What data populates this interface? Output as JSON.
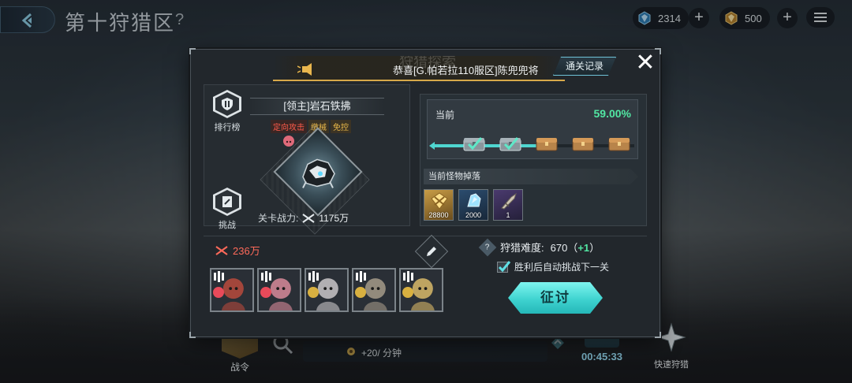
{
  "top_bar": {
    "back_icon": "back-chevron-icon",
    "zone_title": "第十狩猎区",
    "help_mark": "?",
    "currency1_value": "2314",
    "currency1_icon": "blue-crystal-icon",
    "currency2_value": "500",
    "currency2_icon": "gold-crystal-icon",
    "plus": "+",
    "menu_icon": "hamburger-menu-icon"
  },
  "bottom_bar": {
    "pass_label": "战令",
    "rate_text": "+20/ 分钟",
    "timer": "00:45:33",
    "quick_hunt_label": "快速狩猎"
  },
  "modal": {
    "broadcast": "恭喜[G.帕若拉110服区]陈兜兜将",
    "ghost_title": "狩猎探索",
    "records_button": "通关记录",
    "close_icon": "close-x-icon",
    "ranking_label": "排行榜",
    "challenge_label": "挑战",
    "boss": {
      "name": "[领主]岩石铁拂",
      "tags": [
        "定向攻击",
        "缴械",
        "免控"
      ],
      "power_label": "关卡战力:",
      "power_value": "1175万"
    },
    "progress": {
      "label": "当前",
      "percent": "59.00%",
      "fill_fraction": 0.59,
      "milestones": [
        {
          "state": "claimed"
        },
        {
          "state": "claimed"
        },
        {
          "state": "locked"
        },
        {
          "state": "locked"
        },
        {
          "state": "locked"
        }
      ]
    },
    "drops": {
      "title": "当前怪物掉落",
      "items": [
        {
          "name": "gold-currency",
          "qty": "28800"
        },
        {
          "name": "blue-crystal",
          "qty": "2000"
        },
        {
          "name": "weapon-part",
          "qty": "1"
        }
      ]
    },
    "team": {
      "power": "236万",
      "members": [
        {
          "name": "member-1",
          "color": "#b84a3c"
        },
        {
          "name": "member-2",
          "color": "#d88a9a"
        },
        {
          "name": "member-3",
          "color": "#c9c6c8"
        },
        {
          "name": "member-4",
          "color": "#a59a88"
        },
        {
          "name": "member-5",
          "color": "#d8b868"
        }
      ]
    },
    "difficulty_label": "狩猎难度:",
    "difficulty_value": "670",
    "difficulty_open": "（",
    "difficulty_bonus": "+1",
    "difficulty_close": "）",
    "auto_next_label": "胜利后自动挑战下一关",
    "auto_next_checked": true,
    "attack_button": "征讨"
  }
}
